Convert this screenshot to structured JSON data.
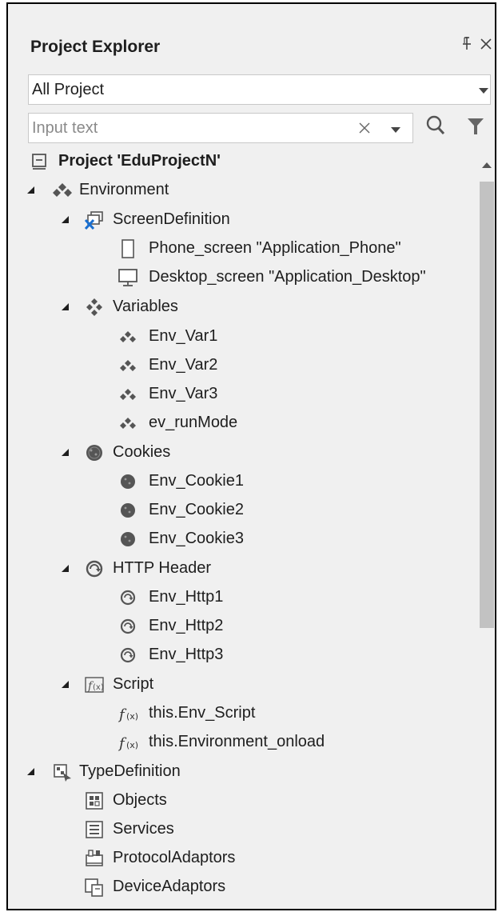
{
  "panel": {
    "title": "Project Explorer",
    "pin_icon": "pin-icon",
    "close_icon": "close-icon"
  },
  "scope": {
    "selected": "All Project"
  },
  "search": {
    "placeholder": "Input text",
    "value": ""
  },
  "colors": {
    "panel_background": "#f0f0f0",
    "scroll_thumb": "#c2c2c2",
    "icon_gray": "#555555",
    "icon_blue": "#1a6fd0"
  },
  "tree": [
    {
      "label": "Project 'EduProjectN'",
      "icon": "project-icon",
      "expanded": null,
      "bold": true
    },
    {
      "label": "Environment",
      "icon": "variables-icon",
      "expanded": true
    },
    {
      "label": "ScreenDefinition",
      "icon": "screen-definition-icon",
      "expanded": true
    },
    {
      "label": "Phone_screen \"Application_Phone\"",
      "icon": "phone-icon"
    },
    {
      "label": "Desktop_screen \"Application_Desktop\"",
      "icon": "desktop-icon"
    },
    {
      "label": "Variables",
      "icon": "variables-icon",
      "expanded": true
    },
    {
      "label": "Env_Var1",
      "icon": "variable-icon"
    },
    {
      "label": "Env_Var2",
      "icon": "variable-icon"
    },
    {
      "label": "Env_Var3",
      "icon": "variable-icon"
    },
    {
      "label": "ev_runMode",
      "icon": "variable-icon"
    },
    {
      "label": "Cookies",
      "icon": "cookie-icon",
      "expanded": true
    },
    {
      "label": "Env_Cookie1",
      "icon": "cookie-icon"
    },
    {
      "label": "Env_Cookie2",
      "icon": "cookie-icon"
    },
    {
      "label": "Env_Cookie3",
      "icon": "cookie-icon"
    },
    {
      "label": "HTTP Header",
      "icon": "http-icon",
      "expanded": true
    },
    {
      "label": "Env_Http1",
      "icon": "http-icon"
    },
    {
      "label": "Env_Http2",
      "icon": "http-icon"
    },
    {
      "label": "Env_Http3",
      "icon": "http-icon"
    },
    {
      "label": "Script",
      "icon": "script-icon",
      "expanded": true
    },
    {
      "label": "this.Env_Script",
      "icon": "function-icon"
    },
    {
      "label": "this.Environment_onload",
      "icon": "function-icon"
    },
    {
      "label": "TypeDefinition",
      "icon": "type-definition-icon",
      "expanded": true
    },
    {
      "label": "Objects",
      "icon": "objects-icon"
    },
    {
      "label": "Services",
      "icon": "services-icon"
    },
    {
      "label": "ProtocolAdaptors",
      "icon": "protocol-adaptor-icon"
    },
    {
      "label": "DeviceAdaptors",
      "icon": "device-adaptor-icon"
    }
  ]
}
